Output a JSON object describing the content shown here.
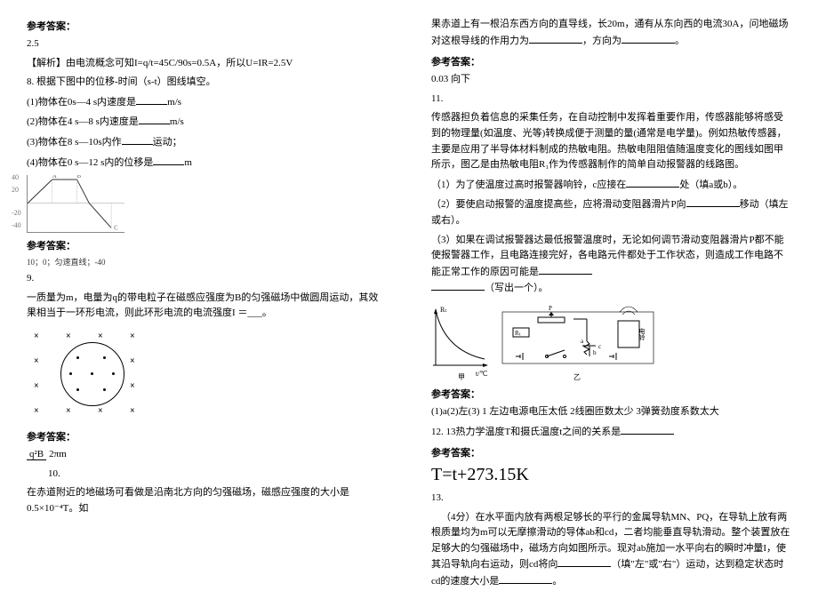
{
  "left": {
    "ans_label": "参考答案：",
    "a1": "2.5",
    "explain": "【解析】由电流概念可知I=q/t=45C/90s=0.5A，所以U=IR=2.5V",
    "q8_title": "8. 根据下图中的位移-时间（s-t）图线填空。",
    "q8_1": "(1)物体在0s—4 s内速度是",
    "unit_ms": "m/s",
    "q8_2": "(2)物体在4 s—8 s内速度是",
    "q8_3": "(3)物体在8 s—10s内作",
    "q8_3_tail": "运动；",
    "q8_4": "(4)物体在0 s—12 s内的位移是",
    "unit_m": "m",
    "graph_y1": "40",
    "graph_y2": "20",
    "graph_y3": "-20",
    "graph_y4": "-40",
    "graph_letters": {
      "a": "A",
      "b": "B",
      "c": "C"
    },
    "a8": "10；0；匀速直线；-40",
    "q9": "9.",
    "q9_text": "一质量为m，电量为q的带电粒子在磁感应强度为B的匀强磁场中做圆周运动，其效果相当于一环形电流，则此环形电流的电流强度I ＝___。",
    "a9_top": "q²B",
    "a9_bot": "2πm",
    "q10": "10.",
    "q10_text": "在赤道附近的地磁场可看做是沿南北方向的匀强磁场，磁感应强度的大小是0.5×10⁻⁴T。如"
  },
  "right": {
    "q10_cont": "果赤道上有一根沿东西方向的直导线，长20m，通有从东向西的电流30A，问地磁场对这根导线的作用力为",
    "q10_tail": "，方向为",
    "period": "。",
    "ans_label": "参考答案：",
    "a10": "0.03 向下",
    "q11": "11.",
    "q11_text": "传感器担负着信息的采集任务，在自动控制中发挥着重要作用，传感器能够将感受到的物理量(如温度、光等)转换成便于测量的量(通常是电学量)。例如热敏传感器，主要是应用了半导体材料制成的热敏电阻。热敏电阻阻值随温度变化的图线如图甲所示，图乙是由热敏电阻R₁作为传感器制作的简单自动报警器的线路图。",
    "q11_1": "（1）为了使温度过高时报警器响铃，c应接在",
    "q11_1_tail": "处（填a或b）。",
    "q11_2": "（2）要使启动报警的温度提高些，应将滑动变阻器滑片P向",
    "q11_2_tail": "移动（填左或右）。",
    "q11_3": "（3）如果在调试报警器达最低报警温度时，无论如何调节滑动变阻器滑片P都不能使报警器工作，且电路连接完好，各电路元件都处于工作状态，则造成工作电路不能正常工作的原因可能是",
    "q11_3_tail": "（写出一个）。",
    "circuit_labels": {
      "Rt": "Rₜ",
      "P": "P",
      "a": "a",
      "b": "b",
      "c": "c",
      "tc": "t/℃",
      "lingxian": "电铃",
      "jia": "甲",
      "yi": "乙"
    },
    "a11": "(1)a(2)左(3) 1 左边电源电压太低  2线圈匝数太少  3弹簧劲度系数太大",
    "q12": "12. 13热力学温度T和摄氏温度t之间的关系是",
    "a12": "T=t+273.15K",
    "q13": "13.",
    "q13_text": "（4分）在水平面内放有两根足够长的平行的金属导轨MN、PQ，在导轨上放有两根质量均为m可以无摩擦滑动的导体ab和cd，二者均能垂直导轨滑动。整个装置放在足够大的匀强磁场中，磁场方向如图所示。现对ab施加一水平向右的瞬时冲量I，使其沿导轨向右运动，则cd将向",
    "q13_tail": "（填\"左\"或\"右\"）运动，达到稳定状态时cd的速度大小是"
  }
}
